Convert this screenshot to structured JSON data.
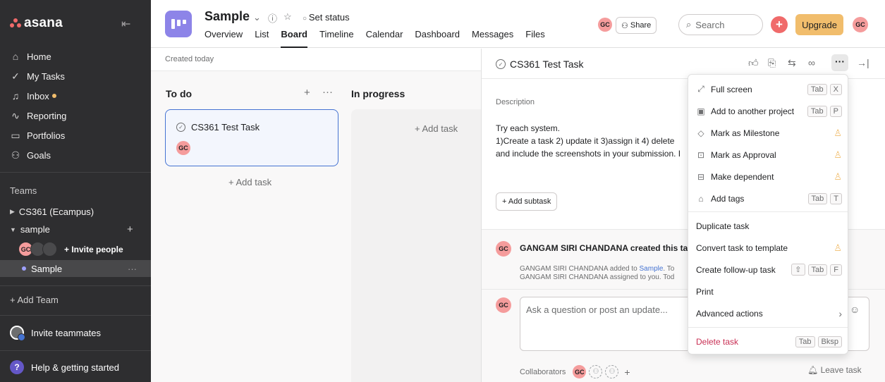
{
  "sidebar": {
    "logo": "asana",
    "nav": [
      {
        "label": "Home",
        "icon": "home-icon"
      },
      {
        "label": "My Tasks",
        "icon": "check-circle-icon"
      },
      {
        "label": "Inbox",
        "icon": "bell-icon"
      },
      {
        "label": "Reporting",
        "icon": "chart-icon"
      },
      {
        "label": "Portfolios",
        "icon": "folder-icon"
      },
      {
        "label": "Goals",
        "icon": "person-icon"
      }
    ],
    "teams_header": "Teams",
    "teams": [
      {
        "label": "CS361 (Ecampus)"
      },
      {
        "label": "sample"
      }
    ],
    "members_initials": "GC",
    "invite_people": "+ Invite people",
    "project": "Sample",
    "add_team": "+ Add Team",
    "invite_teammates": "Invite teammates",
    "help": "Help & getting started"
  },
  "header": {
    "project_title": "Sample",
    "set_status": "Set status",
    "tabs": [
      "Overview",
      "List",
      "Board",
      "Timeline",
      "Calendar",
      "Dashboard",
      "Messages",
      "Files"
    ],
    "active_tab": "Board",
    "avatar_initials": "GC",
    "share": "Share",
    "search_placeholder": "Search",
    "upgrade": "Upgrade"
  },
  "board": {
    "created": "Created today",
    "columns": [
      {
        "title": "To do",
        "add_task": "+ Add task"
      },
      {
        "title": "In progress",
        "add_task": "+ Add task"
      }
    ],
    "card": {
      "title": "CS361 Test Task",
      "assignee": "GC"
    }
  },
  "detail": {
    "title": "CS361 Test Task",
    "description_label": "Description",
    "description_lines": [
      "Try each system.",
      "1)Create a task  2) update it 3)assign it 4) delete",
      "and include the screenshots in your submission. I"
    ],
    "add_subtask": "+ Add subtask",
    "activity_author": "GC",
    "activity_title": "GANGAM SIRI CHANDANA created this ta",
    "activity_line1_name": "GANGAM SIRI CHANDANA",
    "activity_line1_text": " added to ",
    "activity_line1_link": "Sample",
    "activity_line1_tail": ".  To",
    "activity_line2_name": "GANGAM SIRI CHANDANA",
    "activity_line2_text": " assigned to you.  Tod",
    "comment_placeholder": "Ask a question or post an update...",
    "collaborators_label": "Collaborators",
    "collaborator_initials": "GC",
    "leave_task": "Leave task"
  },
  "menu": {
    "items": [
      {
        "label": "Full screen",
        "keys": [
          "Tab",
          "X"
        ]
      },
      {
        "label": "Add to another project",
        "keys": [
          "Tab",
          "P"
        ]
      },
      {
        "label": "Mark as Milestone"
      },
      {
        "label": "Mark as Approval"
      },
      {
        "label": "Make dependent"
      },
      {
        "label": "Add tags",
        "keys": [
          "Tab",
          "T"
        ]
      },
      {
        "label": "Duplicate task"
      },
      {
        "label": "Convert task to template"
      },
      {
        "label": "Create follow-up task",
        "keys": [
          "⇧",
          "Tab",
          "F"
        ]
      },
      {
        "label": "Print"
      },
      {
        "label": "Advanced actions"
      },
      {
        "label": "Delete task",
        "keys": [
          "Tab",
          "Bksp"
        ]
      }
    ]
  },
  "colors": {
    "sidebar_bg": "#2e2e30",
    "accent_blue": "#4573d2",
    "upgrade_bg": "#f1bd6c",
    "danger": "#c92f54",
    "avatar": "#f59c9c"
  }
}
